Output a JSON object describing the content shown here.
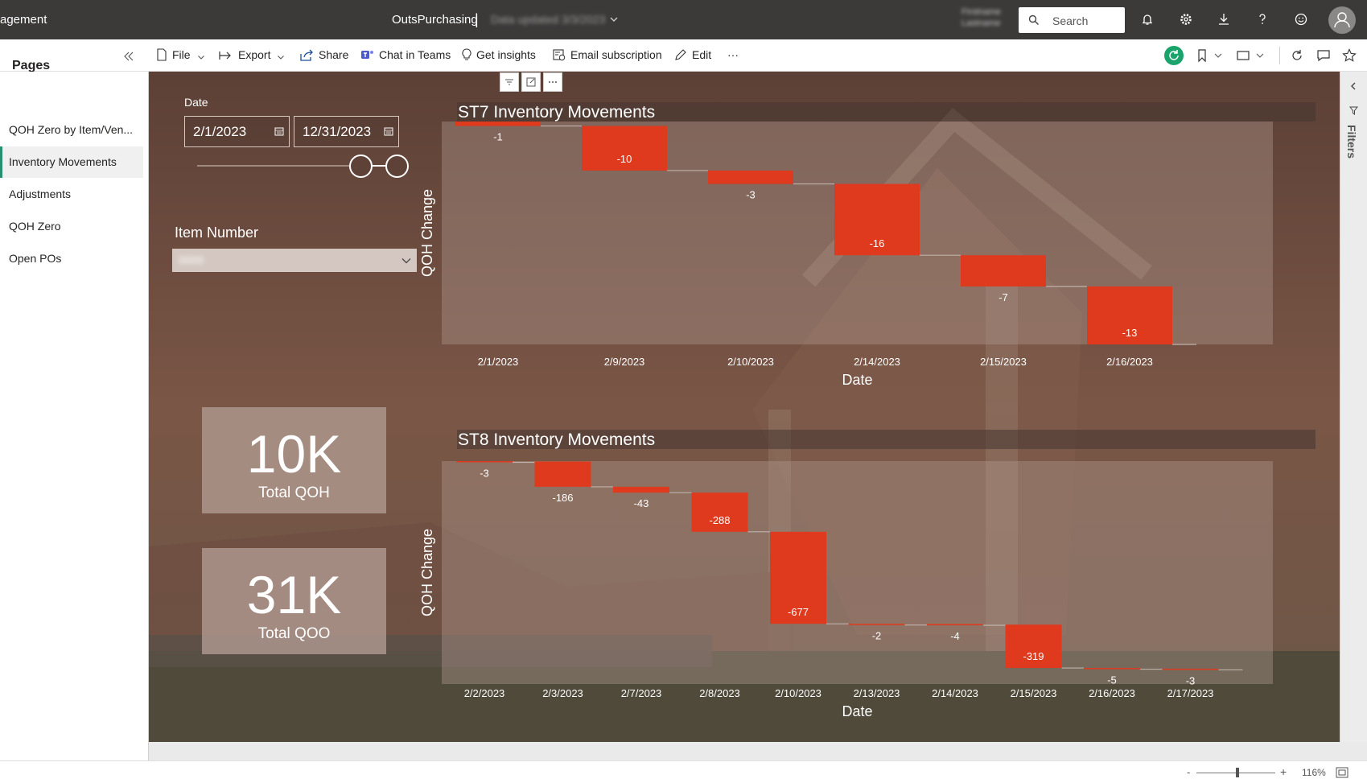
{
  "topbar": {
    "app_title": "agement",
    "report_name": "OutsPurchasing",
    "separator": "|",
    "updated_text": "Data updated 3/3/2023",
    "user_name": "Firstname Lastname",
    "search_placeholder": "Search",
    "icons": [
      "bell-icon",
      "gear-icon",
      "download-icon",
      "help-icon",
      "smiley-icon",
      "avatar-icon"
    ]
  },
  "commandbar": {
    "file": "File",
    "export": "Export",
    "share": "Share",
    "chat": "Chat in Teams",
    "insights": "Get insights",
    "email": "Email subscription",
    "edit": "Edit",
    "more": "···"
  },
  "sidebar": {
    "title": "Pages",
    "items": [
      {
        "label": "QOH Zero by Item/Ven...",
        "active": false
      },
      {
        "label": "Inventory Movements",
        "active": true
      },
      {
        "label": "Adjustments",
        "active": false
      },
      {
        "label": "QOH Zero",
        "active": false
      },
      {
        "label": "Open POs",
        "active": false
      }
    ]
  },
  "slicer": {
    "date_label": "Date",
    "start_date": "2/1/2023",
    "end_date": "12/31/2023",
    "range_start_fraction": 0.82,
    "range_end_fraction": 1.0,
    "item_label": "Item Number",
    "item_value": "0000"
  },
  "kpis": [
    {
      "value": "10K",
      "label": "Total QOH"
    },
    {
      "value": "31K",
      "label": "Total QOO"
    }
  ],
  "filters_label": "Filters",
  "zoom": {
    "minus": "-",
    "plus": "+",
    "value": "116%"
  },
  "accent_color": "#e03a1e",
  "chart_data": [
    {
      "type": "bar",
      "subtype": "waterfall",
      "title": "ST7 Inventory Movements",
      "xlabel": "Date",
      "ylabel": "QOH Change",
      "categories": [
        "2/1/2023",
        "2/9/2023",
        "2/10/2023",
        "2/14/2023",
        "2/15/2023",
        "2/16/2023"
      ],
      "values": [
        -1,
        -10,
        -3,
        -16,
        -7,
        -13
      ],
      "ylim": [
        -50,
        0
      ]
    },
    {
      "type": "bar",
      "subtype": "waterfall",
      "title": "ST8 Inventory Movements",
      "xlabel": "Date",
      "ylabel": "QOH Change",
      "categories": [
        "2/2/2023",
        "2/3/2023",
        "2/7/2023",
        "2/8/2023",
        "2/10/2023",
        "2/13/2023",
        "2/14/2023",
        "2/15/2023",
        "2/16/2023",
        "2/17/2023"
      ],
      "values": [
        -3,
        -186,
        -43,
        -288,
        -677,
        -2,
        -4,
        -319,
        -5,
        -3
      ],
      "ylim": [
        -1640,
        0
      ]
    }
  ]
}
